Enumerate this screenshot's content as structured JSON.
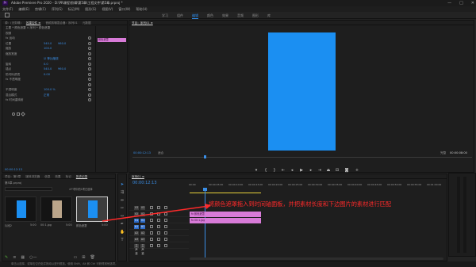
{
  "titlebar": {
    "app_icon": "Pr",
    "title": "Adobe Premiere Pro 2020 - D:\\PR课程\\剪辑\\第5章\\工程文件\\第5章.prproj *",
    "controls": [
      "—",
      "□",
      "✕"
    ]
  },
  "menu": [
    "文件(F)",
    "编辑(E)",
    "剪辑(C)",
    "序列(S)",
    "标记(M)",
    "图形(G)",
    "视图(V)",
    "窗口(W)",
    "帮助(H)"
  ],
  "workspace_tabs": [
    {
      "label": "学习",
      "active": false
    },
    {
      "label": "组件",
      "active": false
    },
    {
      "label": "编辑",
      "active": true
    },
    {
      "label": "颜色",
      "active": false
    },
    {
      "label": "效果",
      "active": false
    },
    {
      "label": "音频",
      "active": false
    },
    {
      "label": "图形",
      "active": false
    },
    {
      "label": "库",
      "active": false
    }
  ],
  "effects_panel": {
    "tabs": [
      "源：(无剪辑)",
      "效果控件 ≡",
      "音频剪辑混合器：序列01",
      "元数据"
    ],
    "source_line": "主要 * 颜色遮罩 ∨   序列 * 颜色遮罩",
    "section_video": "视频",
    "rows": [
      {
        "label": "fx 运动",
        "v": "",
        "v2": ""
      },
      {
        "label": "   位置",
        "v": "540.0",
        "v2": "960.0"
      },
      {
        "label": "   缩放",
        "v": "100.0",
        "v2": ""
      },
      {
        "label": "   缩放宽度",
        "v": "",
        "v2": ""
      },
      {
        "label": "",
        "v": "☑ 等比缩放",
        "v2": ""
      },
      {
        "label": "   旋转",
        "v": "0.0",
        "v2": ""
      },
      {
        "label": "   锚点",
        "v": "540.0",
        "v2": "960.0"
      },
      {
        "label": "   防闪烁滤镜",
        "v": "0.00",
        "v2": ""
      },
      {
        "label": "fx 不透明度",
        "v": "",
        "v2": ""
      },
      {
        "label": "",
        "v": "",
        "v2": ""
      },
      {
        "label": "   不透明度",
        "v": "100.0 %",
        "v2": ""
      },
      {
        "label": "   混合模式",
        "v": "正常",
        "v2": ""
      },
      {
        "label": "fx 时间重映射",
        "v": "",
        "v2": ""
      }
    ],
    "mini_clip": "颜色遮罩",
    "timecode": "00:00:12:13"
  },
  "program_monitor": {
    "tab": "节目：序列01 ≡",
    "timecode": "00:00:12:13",
    "fit": "适合",
    "quality": "完整",
    "duration": "00:00:08:00",
    "frame_color": "#1b8ff2"
  },
  "project_panel": {
    "tabs": [
      "项目：第5章",
      "媒体浏览器",
      "信息",
      "效果",
      "标记",
      "历史记录"
    ],
    "file": "第5章.prproj",
    "items_label": "4个项中的1项已选择",
    "items": [
      {
        "name": "片段2",
        "meta": "5:00"
      },
      {
        "name": "00:1.jpg",
        "meta": "5:00"
      },
      {
        "name": "颜色遮罩",
        "meta": "5:00"
      }
    ]
  },
  "timeline": {
    "tab": "序列01 ≡",
    "timecode": "00:00:12:13",
    "ruler": [
      "00:00",
      "00:00:05:00",
      "00:00:10:00",
      "00:00:15:00",
      "00:00:20:00",
      "00:00:25:00",
      "00:00:30:00",
      "00:00:35:00",
      "00:00:40:00",
      "00:00:45:00",
      "00:00:50:00",
      "00:00:55:00",
      "00:01:00:00"
    ],
    "tracks": [
      {
        "tag": "V3",
        "hl": false
      },
      {
        "tag": "V2",
        "hl": false
      },
      {
        "tag": "V1",
        "hl": true
      },
      {
        "tag": "A1",
        "hl": true
      },
      {
        "tag": "A2",
        "hl": false
      },
      {
        "tag": "A3",
        "hl": false
      },
      {
        "tag": "主声道",
        "hl": false
      }
    ],
    "clips": [
      {
        "label": "fx 颜色遮罩",
        "track": "V2"
      },
      {
        "label": "fx 00:1.jpg",
        "track": "V1"
      }
    ],
    "clip_color": "#d87bd8"
  },
  "annotation": "将颜色遮罩拖入到时间轴面板，并把素材长度和下边图片的素材进行匹配",
  "annotation_color": "#ff2a2a",
  "status": "单击以选择，或单击空白处并拖动以进行框选。使用 Shift、Alt 和 Ctrl 可获得其他选项。"
}
